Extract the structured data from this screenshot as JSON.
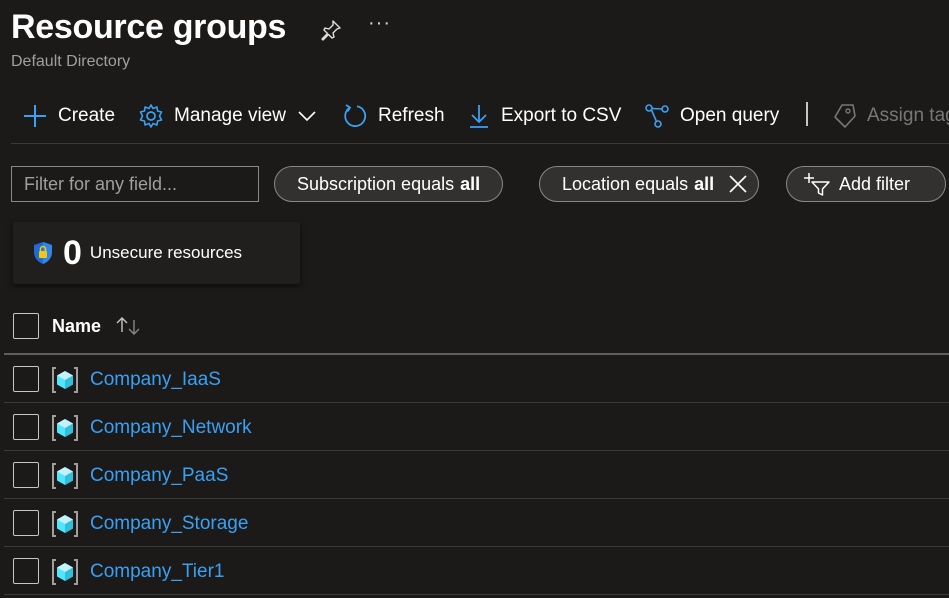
{
  "header": {
    "title": "Resource groups",
    "subtitle": "Default Directory",
    "pin_icon": "pin-icon",
    "more_label": "···"
  },
  "toolbar": {
    "create": "Create",
    "manage_view": "Manage view",
    "refresh": "Refresh",
    "export_csv": "Export to CSV",
    "open_query": "Open query",
    "assign_tags": "Assign tags"
  },
  "filters": {
    "search_placeholder": "Filter for any field...",
    "subscription_label": "Subscription equals",
    "subscription_value": "all",
    "location_label": "Location equals",
    "location_value": "all",
    "add_filter": "Add filter"
  },
  "security_card": {
    "count": "0",
    "label": "Unsecure resources"
  },
  "table": {
    "column_name": "Name",
    "rows": [
      {
        "name": "Company_IaaS"
      },
      {
        "name": "Company_Network"
      },
      {
        "name": "Company_PaaS"
      },
      {
        "name": "Company_Storage"
      },
      {
        "name": "Company_Tier1"
      }
    ]
  },
  "colors": {
    "background": "#1b1a19",
    "accent": "#3aa0f3",
    "link": "#3aa0f3",
    "icon_cube": "#50e6ff"
  }
}
